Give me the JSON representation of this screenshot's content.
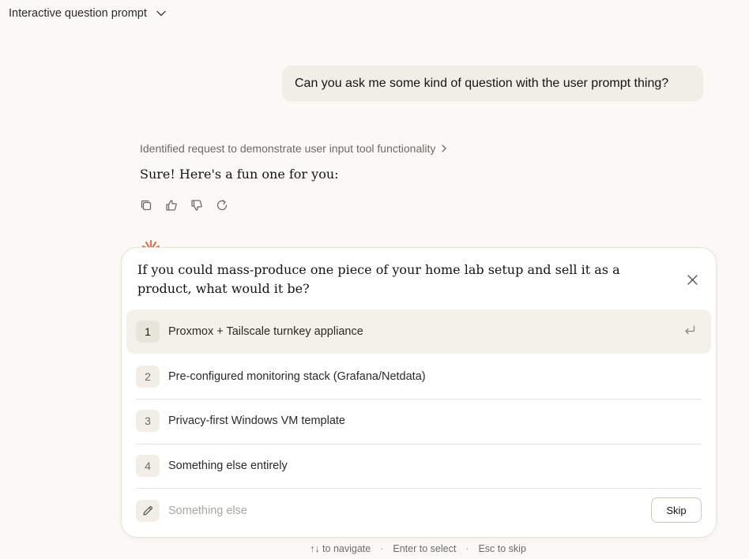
{
  "header": {
    "title": "Interactive question prompt"
  },
  "conversation": {
    "user_message": "Can you ask me some kind of question with the user prompt thing?",
    "thinking_summary": "Identified request to demonstrate user input tool functionality",
    "assistant_message": "Sure! Here's a fun one for you:",
    "actions": [
      "copy",
      "thumbs-up",
      "thumbs-down",
      "retry"
    ]
  },
  "question_card": {
    "question": "If you could mass-produce one piece of your home lab setup and sell it as a product, what would it be?",
    "options": [
      {
        "number": "1",
        "label": "Proxmox + Tailscale turnkey appliance",
        "selected": true
      },
      {
        "number": "2",
        "label": "Pre-configured monitoring stack (Grafana/Netdata)",
        "selected": false
      },
      {
        "number": "3",
        "label": "Privacy-first Windows VM template",
        "selected": false
      },
      {
        "number": "4",
        "label": "Something else entirely",
        "selected": false
      }
    ],
    "free_text_placeholder": "Something else",
    "skip_label": "Skip"
  },
  "hints": {
    "navigate": "↑↓ to navigate",
    "select": "Enter to select",
    "skip": "Esc to skip"
  },
  "colors": {
    "background": "#faf9f5",
    "user_bubble": "#f0eee6",
    "accent_spark": "#d97757"
  }
}
